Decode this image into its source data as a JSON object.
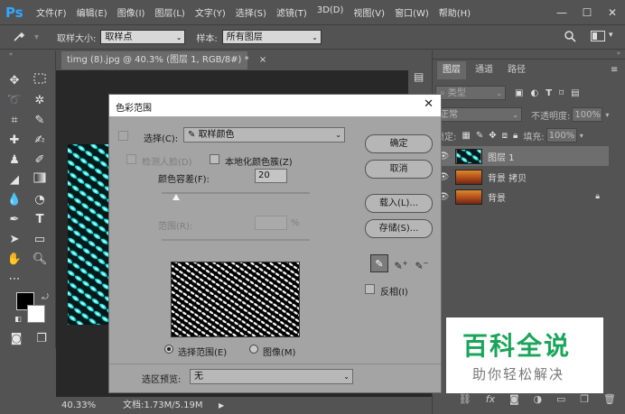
{
  "app": {
    "logo": "Ps"
  },
  "menu": [
    "文件(F)",
    "编辑(E)",
    "图像(I)",
    "图层(L)",
    "文字(Y)",
    "选择(S)",
    "滤镜(T)",
    "3D(D)",
    "视图(V)",
    "窗口(W)",
    "帮助(H)"
  ],
  "window_controls": {
    "minimize": "—",
    "maximize": "☐",
    "close": "✕"
  },
  "options_bar": {
    "sample_size_label": "取样大小:",
    "sample_size_value": "取样点",
    "sample_label": "样本:",
    "sample_value": "所有图层"
  },
  "document": {
    "tab_title": "timg (8).jpg @ 40.3% (图层 1, RGB/8#) *",
    "tab_close": "×",
    "zoom": "40.33%",
    "doc_info": "文档:1.73M/5.19M"
  },
  "panel": {
    "tabs": [
      "图层",
      "通道",
      "路径"
    ],
    "filter_kind": "类型",
    "blend_mode": "正常",
    "opacity_label": "不透明度:",
    "opacity_value": "100%",
    "lock_label": "锁定:",
    "fill_label": "填充:",
    "fill_value": "100%",
    "layers": [
      {
        "name": "图层 1"
      },
      {
        "name": "背景 拷贝"
      },
      {
        "name": "背景",
        "locked": true
      }
    ]
  },
  "dialog": {
    "title": "色彩范围",
    "close": "✕",
    "select_label": "选择(C):",
    "select_value": "取样颜色",
    "detect_faces": "检测人脸(D)",
    "localized_clusters": "本地化颜色簇(Z)",
    "fuzziness_label": "颜色容差(F):",
    "fuzziness_value": "20",
    "fuzziness_fraction": 0.1,
    "range_label": "范围(R):",
    "range_unit": "%",
    "buttons": {
      "ok": "确定",
      "cancel": "取消",
      "load": "载入(L)...",
      "save": "存储(S)..."
    },
    "invert": "反相(I)",
    "view_selection": "选择范围(E)",
    "view_image": "图像(M)",
    "preview_label": "选区预览:",
    "preview_value": "无"
  },
  "watermark": {
    "title": "百科全说",
    "subtitle": "助你轻松解决"
  },
  "colors": {
    "panel_bg": "#535353",
    "dialog_bg": "#a4a4a4",
    "accent": "#31a8ff",
    "pattern_cyan": "#27e0dc",
    "watermark_green": "#1aa55a"
  }
}
